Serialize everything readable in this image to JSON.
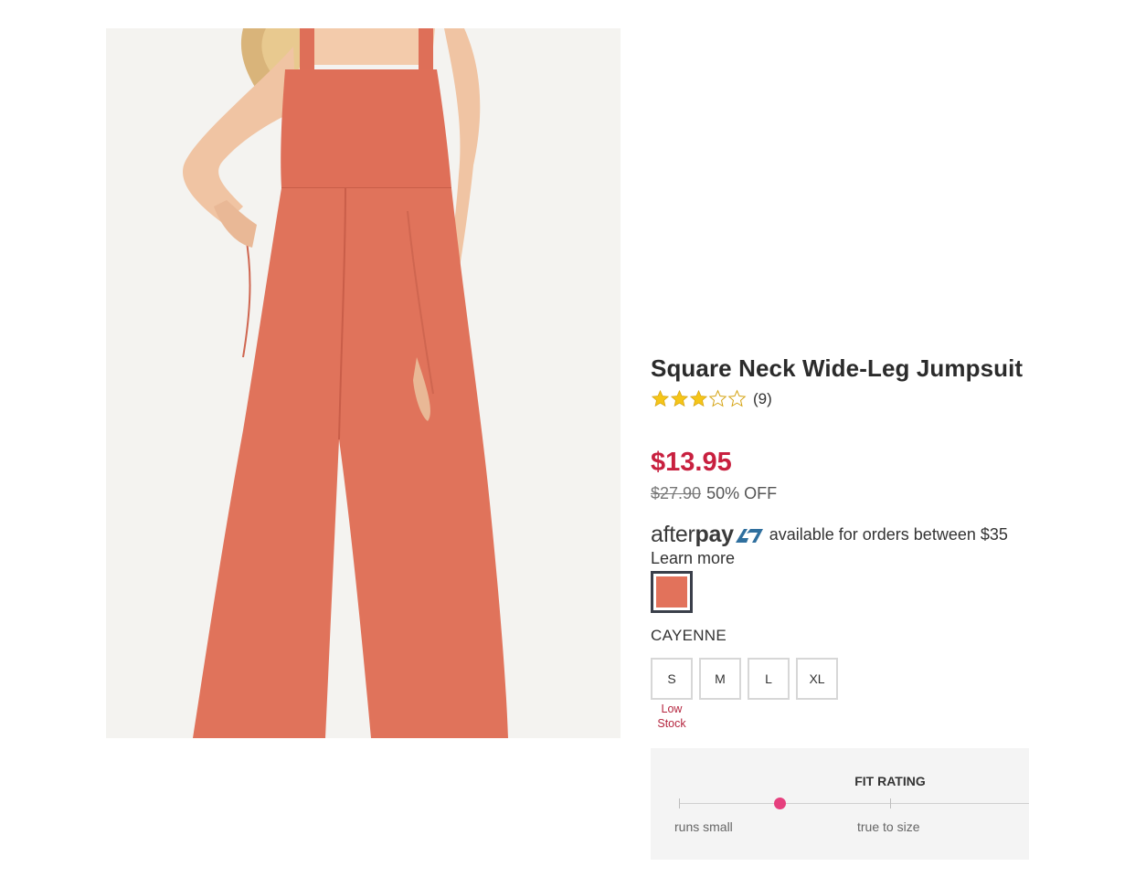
{
  "product": {
    "title": "Square Neck Wide-Leg Jumpsuit",
    "rating_stars": 3,
    "rating_max": 5,
    "review_count": "(9)",
    "sale_price": "$13.95",
    "original_price": "$27.90",
    "discount": "50% OFF"
  },
  "afterpay": {
    "logo_after": "after",
    "logo_pay": "pay",
    "text": "available for orders between $35",
    "learn_more": "Learn more"
  },
  "color": {
    "name": "CAYENNE",
    "swatch_hex": "#e2725b"
  },
  "sizes": {
    "options": [
      "S",
      "M",
      "L",
      "XL"
    ],
    "low_stock_note": "Low Stock"
  },
  "fit_rating": {
    "title": "FIT RATING",
    "low_label": "runs small",
    "mid_label": "true to size"
  },
  "colors": {
    "sale_price": "#c8203f",
    "star": "#f5c518",
    "fit_dot": "#e6407e",
    "afterpay_badge": "#2f6f9e"
  }
}
